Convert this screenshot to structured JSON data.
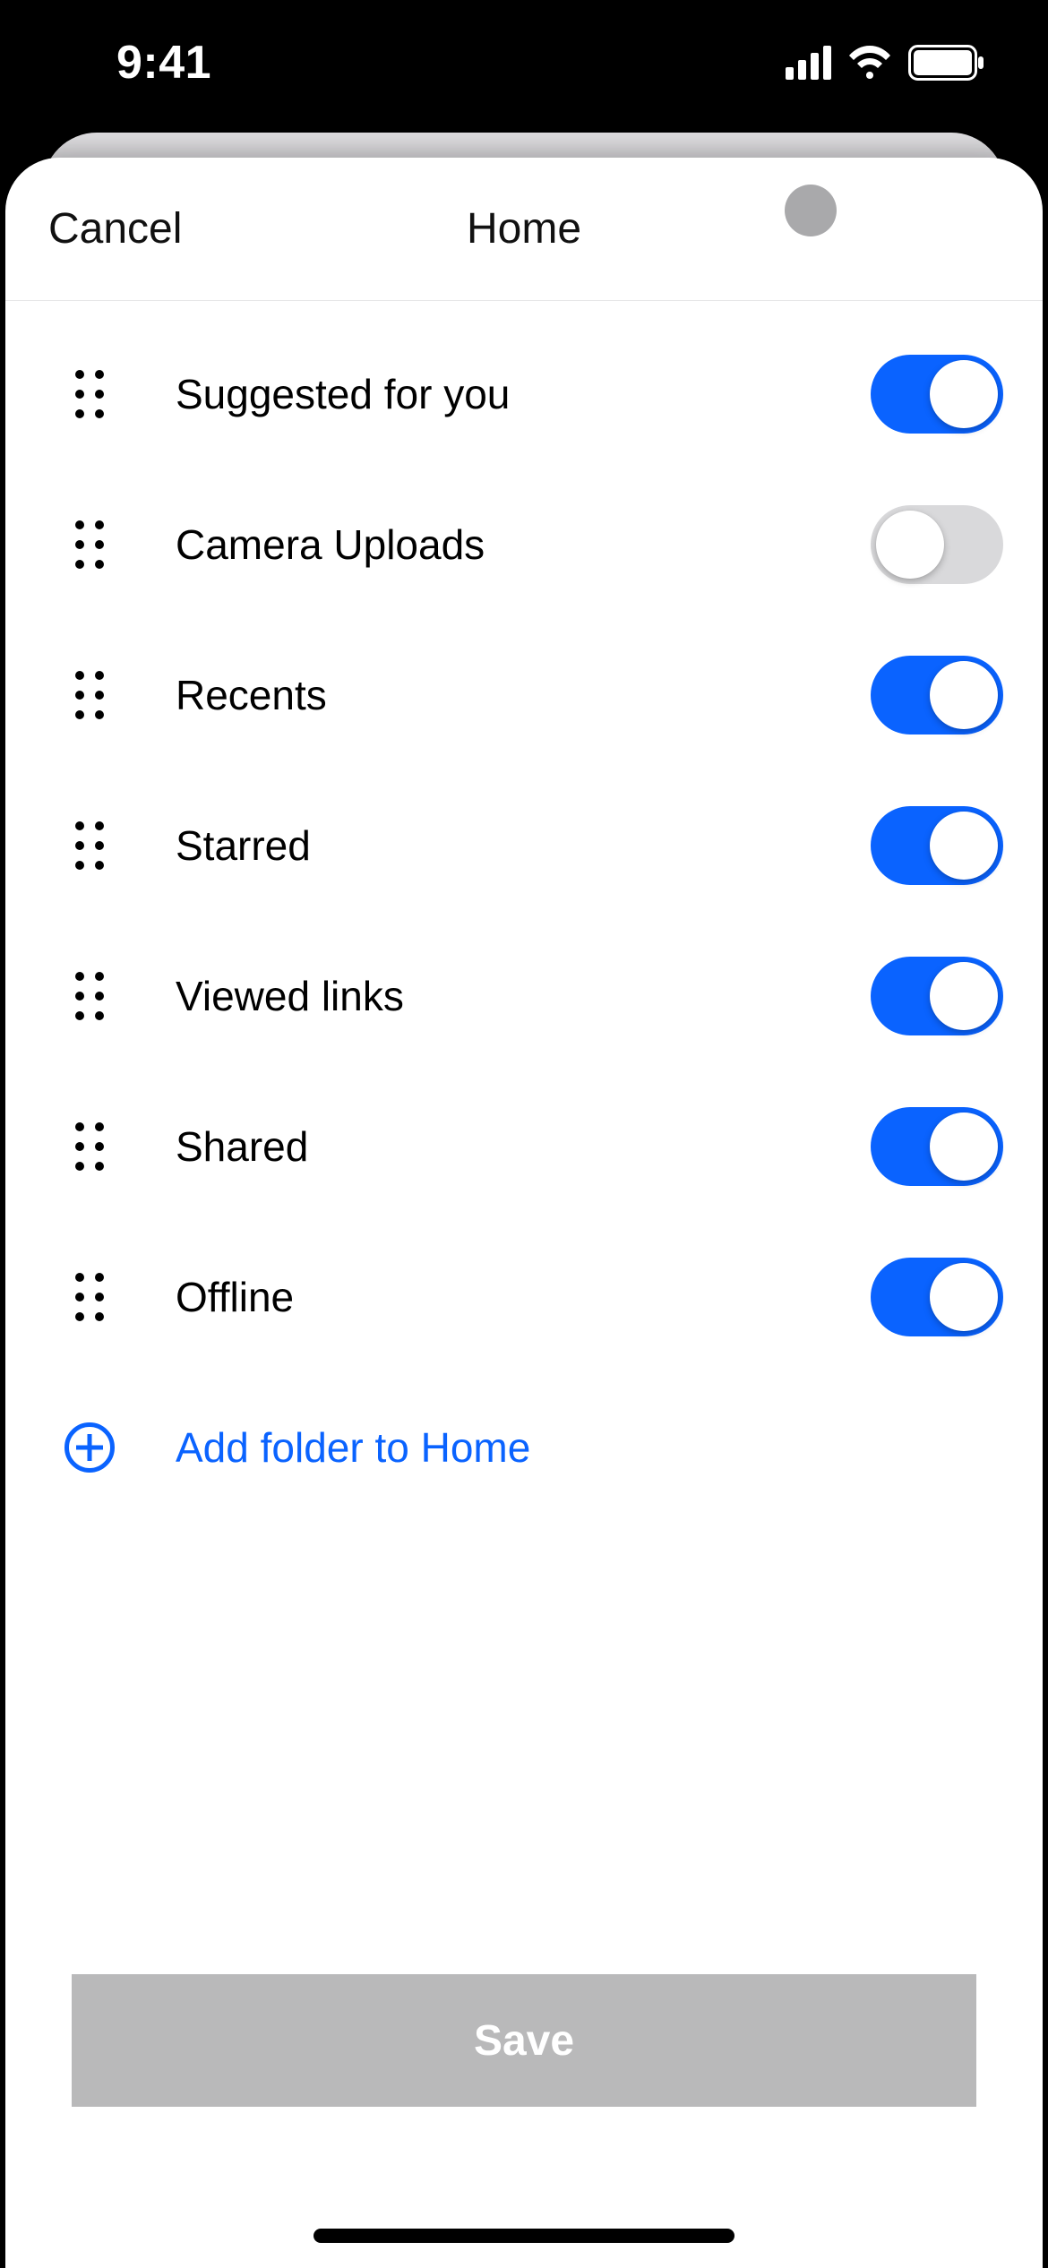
{
  "status": {
    "time": "9:41"
  },
  "header": {
    "cancel_label": "Cancel",
    "title": "Home"
  },
  "rows": [
    {
      "label": "Suggested for you",
      "on": true
    },
    {
      "label": "Camera Uploads",
      "on": false
    },
    {
      "label": "Recents",
      "on": true
    },
    {
      "label": "Starred",
      "on": true
    },
    {
      "label": "Viewed links",
      "on": true
    },
    {
      "label": "Shared",
      "on": true
    },
    {
      "label": "Offline",
      "on": true
    }
  ],
  "add_folder_label": "Add folder to Home",
  "save_label": "Save",
  "colors": {
    "accent": "#0a63ff",
    "toggle_off": "#d9d9db",
    "save_bg": "#b9b9ba"
  }
}
